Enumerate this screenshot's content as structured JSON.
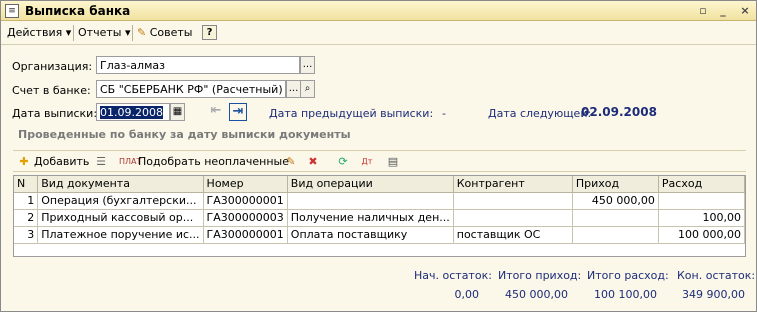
{
  "window": {
    "title": "Выписка банка",
    "icon": "document-icon"
  },
  "toolbar": {
    "actions_label": "Действия",
    "reports_label": "Отчеты",
    "tips_label": "Советы",
    "help_label": "?"
  },
  "form": {
    "org_label": "Организация:",
    "org_value": "Глаз-алмаз",
    "account_label": "Счет в банке:",
    "account_value": "СБ \"СБЕРБАНК РФ\" (Расчетный)",
    "date_label": "Дата выписки:",
    "date_value": "01.09.2008",
    "prev_label": "Дата предыдущей выписки:",
    "prev_value": "-",
    "next_label": "Дата следующей:",
    "next_value": "02.09.2008"
  },
  "section": {
    "title": "Проведенные по банку за дату выписки документы"
  },
  "subtoolbar": {
    "add_label": "Добавить",
    "select_unpaid_label": "Подобрать неоплаченные"
  },
  "table": {
    "columns": [
      "N",
      "Вид документа",
      "Номер",
      "Вид операции",
      "Контрагент",
      "Приход",
      "Расход"
    ],
    "rows": [
      [
        "1",
        "Операция (бухгалтерски...",
        "ГА300000001",
        "",
        "",
        "450 000,00",
        ""
      ],
      [
        "2",
        "Приходный кассовый ор...",
        "ГА300000003",
        "Получение наличных ден...",
        "",
        "",
        "100,00"
      ],
      [
        "3",
        "Платежное поручение ис...",
        "ГА300000001",
        "Оплата поставщику",
        "поставщик ОС",
        "",
        "100 000,00"
      ]
    ]
  },
  "totals": {
    "start_label": "Нач. остаток:",
    "start_value": "0,00",
    "income_label": "Итого приход:",
    "income_value": "450 000,00",
    "expense_label": "Итого расход:",
    "expense_value": "100 100,00",
    "end_label": "Кон. остаток:",
    "end_value": "349 900,00"
  }
}
